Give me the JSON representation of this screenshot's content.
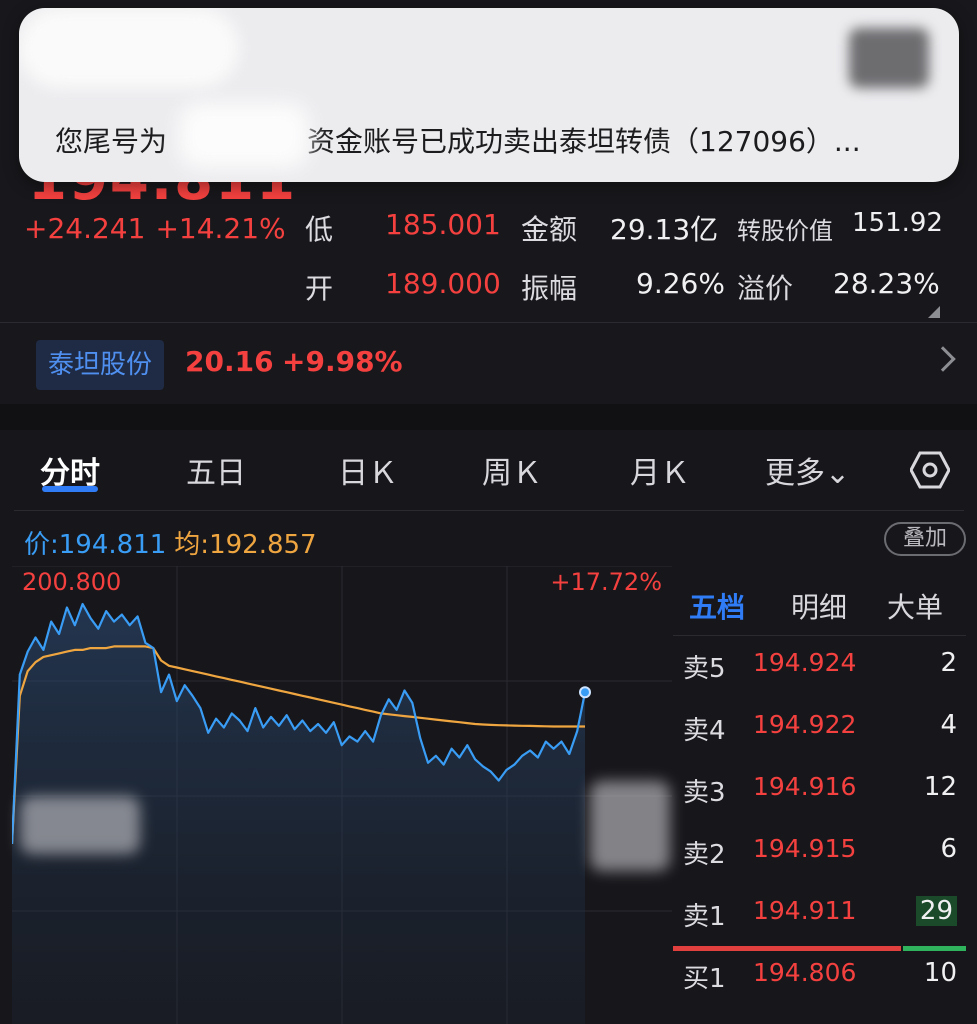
{
  "quote": {
    "price": "194.811",
    "change": "+24.241",
    "change_pct": "+14.21%",
    "low_label": "低",
    "low_value": "185.001",
    "open_label": "开",
    "open_value": "189.000",
    "amount_label": "金额",
    "amount_value": "29.13亿",
    "amplitude_label": "振幅",
    "amplitude_value": "9.26%",
    "conv_value_label": "转股价值",
    "conv_value": "151.92",
    "premium_label": "溢价",
    "premium_value": "28.23%",
    "stock_name": "泰坦股份",
    "stock_price": "20.16",
    "stock_change_pct": "+9.98%"
  },
  "notification": {
    "text": "您尾号为　　　　　资金账号已成功卖出泰坦转债（127096）..."
  },
  "tabs": [
    {
      "label": "分时",
      "active": true
    },
    {
      "label": "五日",
      "active": false
    },
    {
      "label": "日Ｋ",
      "active": false
    },
    {
      "label": "周Ｋ",
      "active": false
    },
    {
      "label": "月Ｋ",
      "active": false
    },
    {
      "label": "更多⌄",
      "active": false
    }
  ],
  "chart_info": {
    "price_label": "价:",
    "price_value": "194.811",
    "avg_label": "均:",
    "avg_value": "192.857",
    "overlay_label": "叠加",
    "top_price": "200.800",
    "top_pct": "+17.72%"
  },
  "chart_data": {
    "type": "line",
    "ylim_top": 200.8,
    "series": [
      {
        "values": [
          186.2,
          195.8,
          197.1,
          197.9,
          197.2,
          198.8,
          198.1,
          199.6,
          198.6,
          199.8,
          199.0,
          198.4,
          199.4,
          198.8,
          199.2,
          198.6,
          199.1,
          197.6,
          197.3,
          194.8,
          195.8,
          194.3,
          195.2,
          194.6,
          193.9,
          192.5,
          193.3,
          192.8,
          193.6,
          193.2,
          192.6,
          193.9,
          192.8,
          193.4,
          192.9,
          193.5,
          192.7,
          193.2,
          192.6,
          193.0,
          192.5,
          193.1,
          191.8,
          192.3,
          192.0,
          192.6,
          192.0,
          193.5,
          194.4,
          193.8,
          194.9,
          194.2,
          192.2,
          190.8,
          191.2,
          190.7,
          191.6,
          191.1,
          191.8,
          191.0,
          190.6,
          190.3,
          189.8,
          190.4,
          190.7,
          191.2,
          191.5,
          191.1,
          192.0,
          191.6,
          192.0,
          191.3,
          192.6,
          194.8
        ],
        "color": "#3a9df5"
      },
      {
        "values": [
          186.2,
          194.6,
          196.0,
          196.5,
          196.8,
          196.9,
          197.0,
          197.1,
          197.2,
          197.2,
          197.3,
          197.3,
          197.3,
          197.4,
          197.4,
          197.4,
          197.4,
          197.4,
          197.3,
          196.6,
          196.3,
          196.2,
          196.1,
          196.0,
          195.9,
          195.8,
          195.7,
          195.6,
          195.5,
          195.4,
          195.3,
          195.2,
          195.1,
          195.0,
          194.9,
          194.8,
          194.7,
          194.6,
          194.5,
          194.4,
          194.3,
          194.2,
          194.1,
          194.0,
          193.9,
          193.8,
          193.7,
          193.6,
          193.55,
          193.5,
          193.45,
          193.4,
          193.35,
          193.3,
          193.25,
          193.2,
          193.15,
          193.1,
          193.05,
          193.0,
          192.97,
          192.95,
          192.93,
          192.92,
          192.91,
          192.9,
          192.89,
          192.88,
          192.87,
          192.86,
          192.86,
          192.86,
          192.86,
          192.857
        ],
        "color": "#f0a640"
      }
    ]
  },
  "orderbook": {
    "tabs": [
      "五档",
      "明细",
      "大单"
    ],
    "rows": [
      {
        "side": "卖5",
        "price": "194.924",
        "vol": "2"
      },
      {
        "side": "卖4",
        "price": "194.922",
        "vol": "4"
      },
      {
        "side": "卖3",
        "price": "194.916",
        "vol": "12"
      },
      {
        "side": "卖2",
        "price": "194.915",
        "vol": "6"
      },
      {
        "side": "卖1",
        "price": "194.911",
        "vol": "29"
      },
      {
        "side": "买1",
        "price": "194.806",
        "vol": "10"
      }
    ]
  }
}
